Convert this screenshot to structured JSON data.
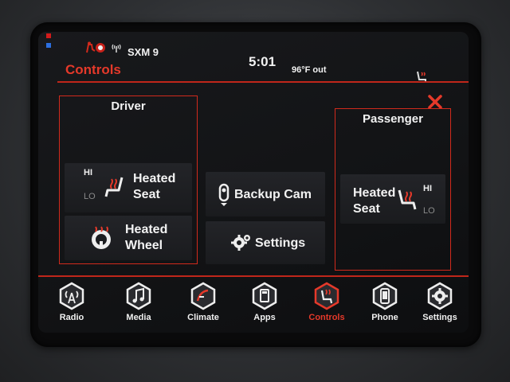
{
  "status": {
    "station": "SXM 9",
    "time": "5:01",
    "temperature": "96°F out",
    "icons": [
      "indicator-light",
      "seatbelt-warning-icon",
      "radio-signal-icon",
      "heated-seat-status-icon"
    ]
  },
  "screen_title": "Controls",
  "driver": {
    "title": "Driver",
    "heated_seat": {
      "label_line1": "Heated",
      "label_line2": "Seat",
      "hi": "HI",
      "lo": "LO"
    },
    "heated_wheel": {
      "label_line1": "Heated",
      "label_line2": "Wheel"
    }
  },
  "center": {
    "backup_cam": "Backup Cam",
    "settings": "Settings"
  },
  "passenger": {
    "title": "Passenger",
    "heated_seat": {
      "label_line1": "Heated",
      "label_line2": "Seat",
      "hi": "HI",
      "lo": "LO"
    }
  },
  "nav": [
    {
      "label": "Radio",
      "icon": "radio-tower-icon"
    },
    {
      "label": "Media",
      "icon": "music-note-icon"
    },
    {
      "label": "Climate",
      "icon": "climate-icon"
    },
    {
      "label": "Apps",
      "icon": "apps-icon"
    },
    {
      "label": "Controls",
      "icon": "controls-icon",
      "active": true
    },
    {
      "label": "Phone",
      "icon": "phone-icon"
    },
    {
      "label": "Settings",
      "icon": "gear-icon"
    }
  ],
  "colors": {
    "accent": "#e5392a",
    "background": "#121315"
  }
}
